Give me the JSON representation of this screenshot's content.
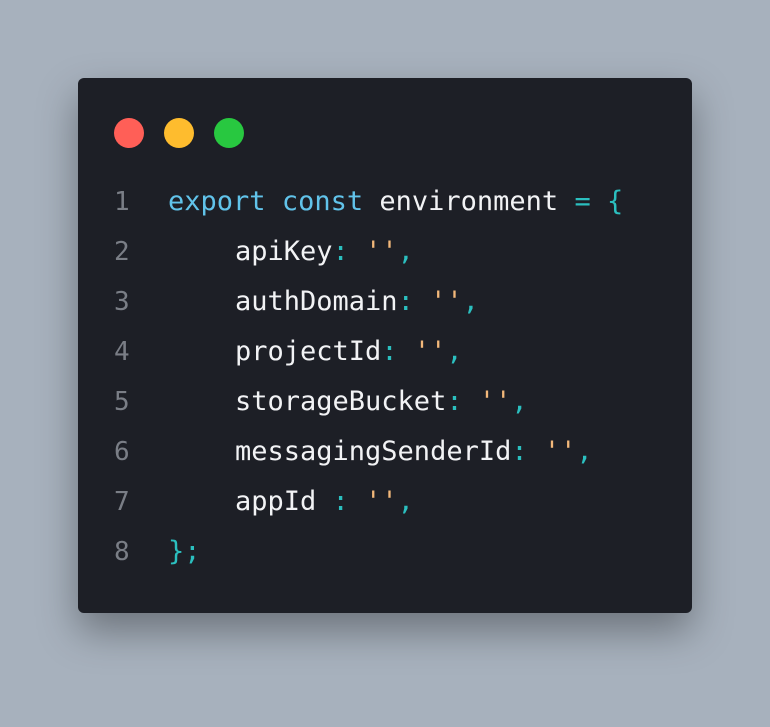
{
  "window": {
    "controls": [
      {
        "name": "close",
        "color": "#ff5f57"
      },
      {
        "name": "minimize",
        "color": "#febc2e"
      },
      {
        "name": "maximize",
        "color": "#28c840"
      }
    ]
  },
  "code": {
    "lines": [
      {
        "number": "1",
        "tokens": {
          "kw1": "export",
          "kw2": "const",
          "ident": "environment",
          "eq": "=",
          "brace": "{"
        }
      },
      {
        "number": "2",
        "tokens": {
          "key": "apiKey",
          "colon": ":",
          "value": "''",
          "comma": ","
        }
      },
      {
        "number": "3",
        "tokens": {
          "key": "authDomain",
          "colon": ":",
          "value": "''",
          "comma": ","
        }
      },
      {
        "number": "4",
        "tokens": {
          "key": "projectId",
          "colon": ":",
          "value": "''",
          "comma": ","
        }
      },
      {
        "number": "5",
        "tokens": {
          "key": "storageBucket",
          "colon": ":",
          "value": "''",
          "comma": ","
        }
      },
      {
        "number": "6",
        "tokens": {
          "key": "messagingSenderId",
          "colon": ":",
          "value": "''",
          "comma": ","
        }
      },
      {
        "number": "7",
        "tokens": {
          "key": "appId",
          "colon": " :",
          "value": "''",
          "comma": ","
        }
      },
      {
        "number": "8",
        "tokens": {
          "close": "};"
        }
      }
    ]
  },
  "colors": {
    "background": "#a7b1bd",
    "editor": "#1d1f26",
    "keyword": "#61c3ea",
    "identifier": "#f2f3f5",
    "operator": "#2bbfbf",
    "string": "#f3b87a",
    "line_number": "#7a7e86"
  }
}
